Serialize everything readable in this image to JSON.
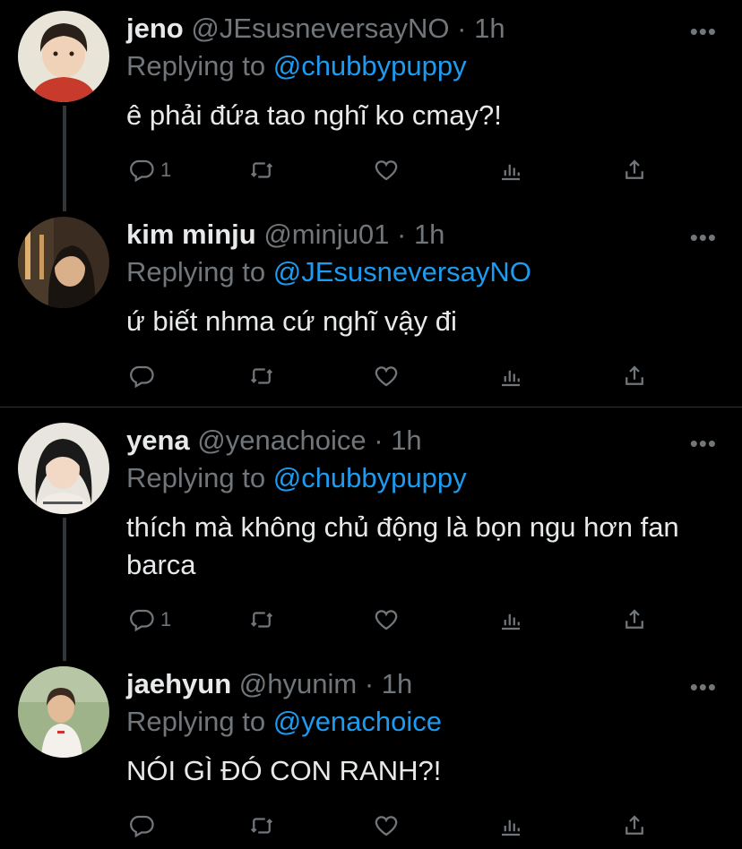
{
  "tweets": [
    {
      "name": "jeno",
      "handle": "@JEsusneversayNO",
      "dot": "·",
      "time": "1h",
      "replying_prefix": "Replying to",
      "replying_to": "@chubbypuppy",
      "text": "ê phải đứa tao nghĩ ko cmay?!",
      "reply_count": "1",
      "avatar_colors": [
        "#e9e4d8",
        "#2a201a",
        "#c73a2c"
      ]
    },
    {
      "name": "kim minju",
      "handle": "@minju01",
      "dot": "·",
      "time": "1h",
      "replying_prefix": "Replying to",
      "replying_to": "@JEsusneversayNO",
      "text": "ứ biết nhma cứ nghĩ vậy đi",
      "reply_count": "",
      "avatar_colors": [
        "#4a3a2a",
        "#1a1410",
        "#d9b08a"
      ]
    },
    {
      "name": "yena",
      "handle": "@yenachoice",
      "dot": "·",
      "time": "1h",
      "replying_prefix": "Replying to",
      "replying_to": "@chubbypuppy",
      "text": "thích mà không chủ động là bọn ngu hơn fan barca",
      "reply_count": "1",
      "avatar_colors": [
        "#e8e4de",
        "#1a1a1a",
        "#f2ece6"
      ]
    },
    {
      "name": "jaehyun",
      "handle": "@hyunim",
      "dot": "·",
      "time": "1h",
      "replying_prefix": "Replying to",
      "replying_to": "@yenachoice",
      "text": "NÓI GÌ ĐÓ CON RANH?!",
      "reply_count": "",
      "avatar_colors": [
        "#9fb38a",
        "#3a2a20",
        "#f4f1ec"
      ]
    }
  ],
  "more_label": "•••",
  "colors": {
    "background": "#000000",
    "text": "#e7e9ea",
    "muted": "#71767b",
    "link": "#1d9bf0",
    "divider": "#2f3336"
  },
  "icons": [
    "reply-icon",
    "retweet-icon",
    "like-icon",
    "analytics-icon",
    "share-icon",
    "more-icon"
  ]
}
